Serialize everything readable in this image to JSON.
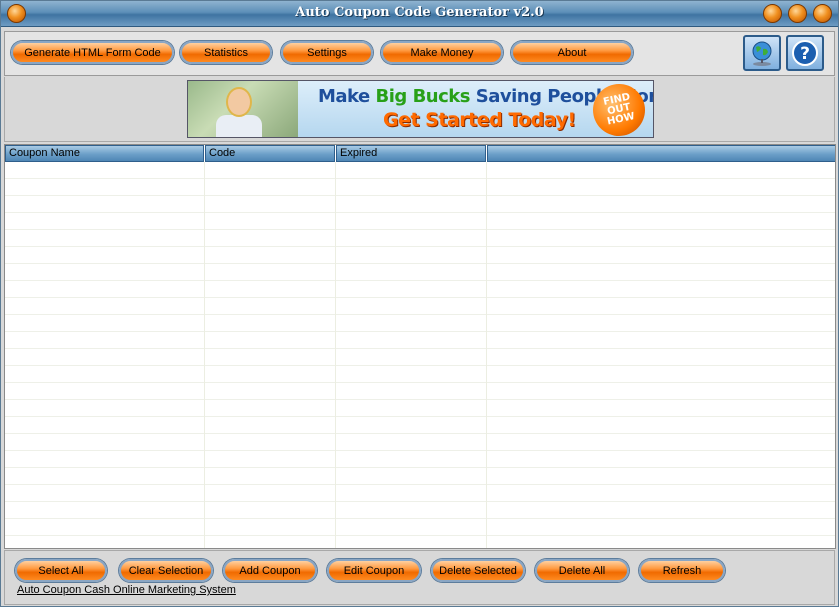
{
  "window": {
    "title": "Auto Coupon Code Generator v2.0"
  },
  "toolbar": {
    "buttons": [
      "Generate HTML Form Code",
      "Statistics",
      "Settings",
      "Make Money",
      "About"
    ],
    "globe_icon": "globe-icon",
    "help_icon": "help-icon"
  },
  "banner": {
    "line1_a": "Make ",
    "line1_b": "Big Bucks",
    "line1_c": " Saving People Money...",
    "line2": "Get Started Today!",
    "cta_1": "FIND",
    "cta_2": "OUT",
    "cta_3": "HOW"
  },
  "table": {
    "columns": [
      "Coupon Name",
      "Code",
      "Expired",
      ""
    ],
    "rows": []
  },
  "actions": {
    "buttons": [
      "Select All",
      "Clear Selection",
      "Add Coupon",
      "Edit Coupon",
      "Delete Selected",
      "Delete All",
      "Refresh"
    ]
  },
  "footer": {
    "link": "Auto Coupon Cash Online Marketing System"
  },
  "colors": {
    "accent": "#ff8a20",
    "header": "#6b9fc8",
    "titlebar": "#3f74a2"
  }
}
